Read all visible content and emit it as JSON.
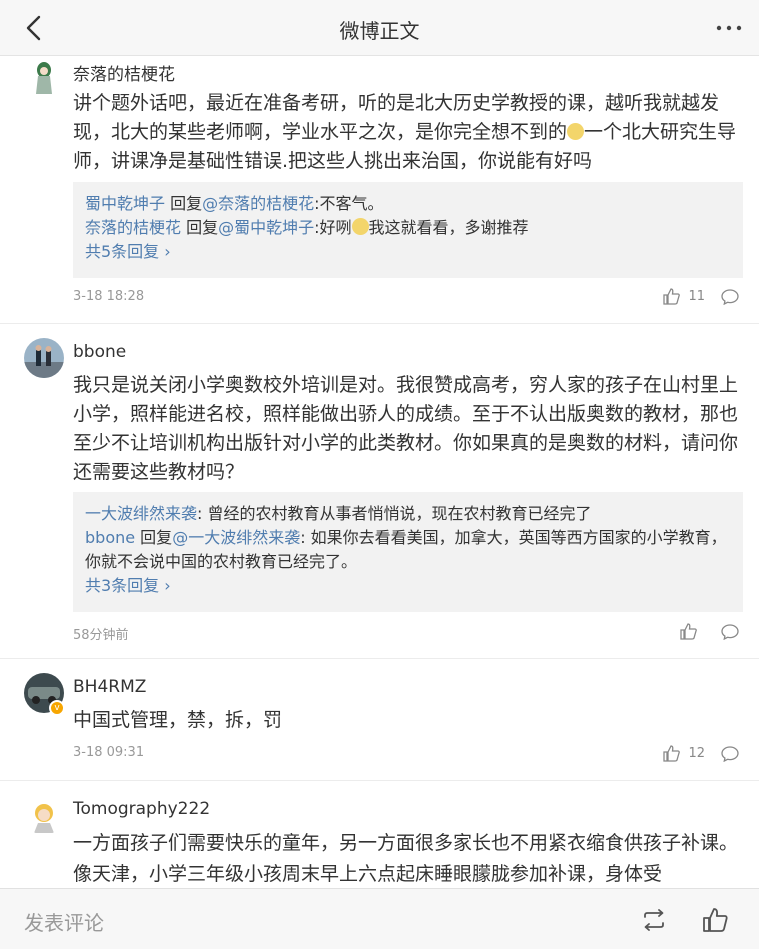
{
  "header": {
    "title": "微博正文"
  },
  "comments": [
    {
      "user": "奈落的桔梗花",
      "text_a": "讲个题外话吧，最近在准备考研，听的是北大历史学教授的课，越听我就越发现，北大的某些老师啊，学业水平之次，是你完全想不到的",
      "text_b": "一个北大研究生导师，讲课净是基础性错误.把这些人挑出来治国，你说能有好吗",
      "replies": [
        {
          "from": "蜀中乾坤子",
          "verb": " 回复",
          "to": "@奈落的桔梗花",
          "text": ":不客气。"
        },
        {
          "from": "奈落的桔梗花",
          "verb": " 回复",
          "to": "@蜀中乾坤子",
          "text_a": ":好咧",
          "text_b": "我这就看看，多谢推荐"
        }
      ],
      "more": "共5条回复",
      "time": "3-18 18:28",
      "likes": "11"
    },
    {
      "user": "bbone",
      "text": "我只是说关闭小学奥数校外培训是对。我很赞成高考，穷人家的孩子在山村里上小学，照样能进名校，照样能做出骄人的成绩。至于不认出版奥数的教材，那也至少不让培训机构出版针对小学的此类教材。你如果真的是奥数的材料，请问你还需要这些教材吗？",
      "replies": [
        {
          "from": "一大波绯然来袭",
          "text": ": 曾经的农村教育从事者悄悄说，现在农村教育已经完了"
        },
        {
          "from": "bbone",
          "verb": " 回复",
          "to": "@一大波绯然来袭",
          "text": ": 如果你去看看美国，加拿大，英国等西方国家的小学教育，你就不会说中国的农村教育已经完了。"
        }
      ],
      "more": "共3条回复",
      "time": "58分钟前",
      "likes": ""
    },
    {
      "user": "BH4RMZ",
      "text": "中国式管理，禁，拆，罚",
      "time": "3-18 09:31",
      "likes": "12"
    },
    {
      "user": "Tomography222",
      "text": "一方面孩子们需要快乐的童年，另一方面很多家长也不用紧衣缩食供孩子补课。像天津，小学三年级小孩周末早上六点起床睡眼朦胧参加补课，身体受"
    }
  ],
  "bottom": {
    "placeholder": "发表评论"
  },
  "colors": {
    "link": "#507daf",
    "verified": "#f7a600"
  }
}
